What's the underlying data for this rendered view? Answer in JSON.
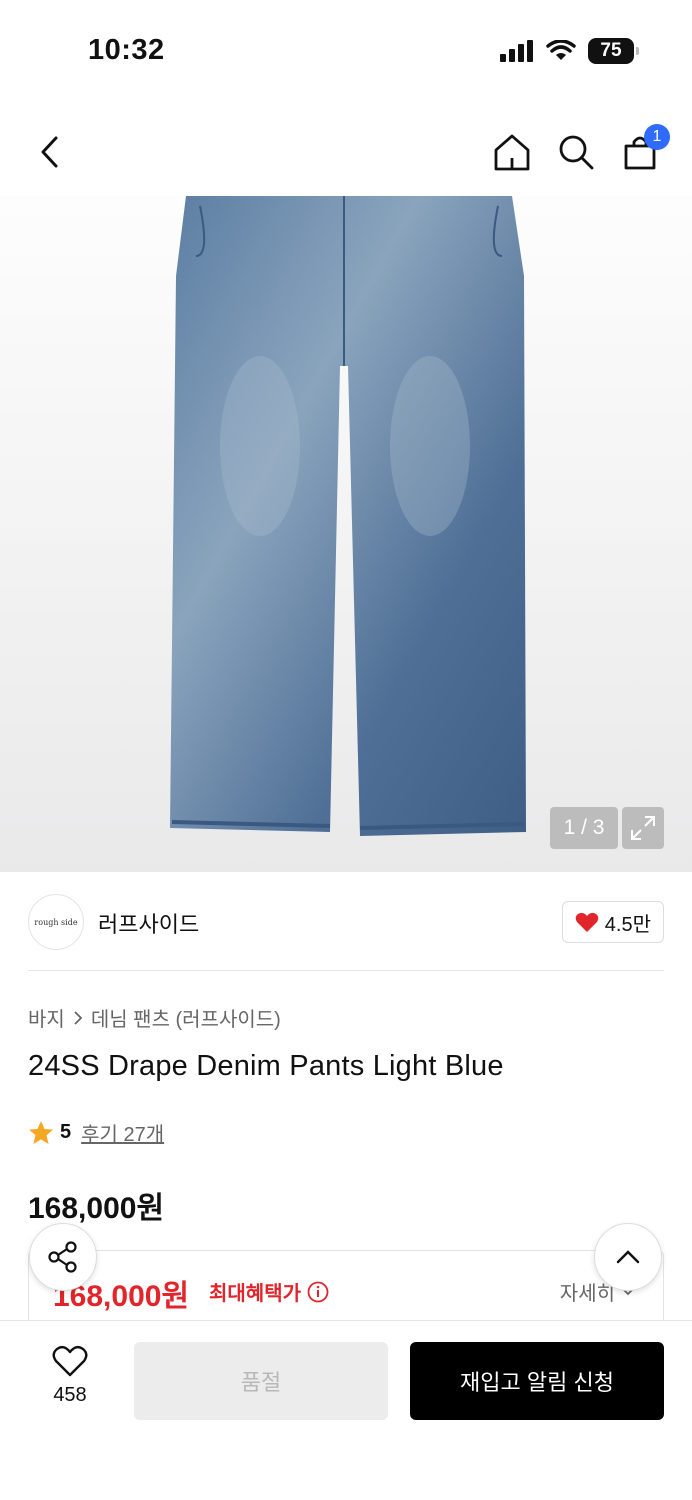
{
  "status": {
    "time": "10:32",
    "battery": "75"
  },
  "nav": {
    "cart_count": "1",
    "icons": [
      "back-icon",
      "home-icon",
      "search-icon",
      "cart-icon"
    ]
  },
  "image": {
    "counter": "1 / 3"
  },
  "brand": {
    "logo_text": "rough side",
    "name": "러프사이드",
    "likes": "4.5만",
    "heart_color": "#e1252a"
  },
  "breadcrumb": {
    "category": "바지",
    "subcategory": "데님 팬츠 (러프사이드)"
  },
  "product": {
    "title": "24SS Drape Denim Pants Light Blue",
    "rating": "5",
    "reviews": "후기 27개",
    "price": "168,000원"
  },
  "benefit": {
    "price": "168,000원",
    "label": "최대혜택가",
    "detail": "자세히",
    "color": "#e1252a"
  },
  "actions": {
    "wish_count": "458",
    "soldout_label": "품절",
    "restock_label": "재입고 알림 신청"
  },
  "colors": {
    "accent": "#2f6bff",
    "primary_button": "#000000",
    "star": "#f5a623"
  }
}
